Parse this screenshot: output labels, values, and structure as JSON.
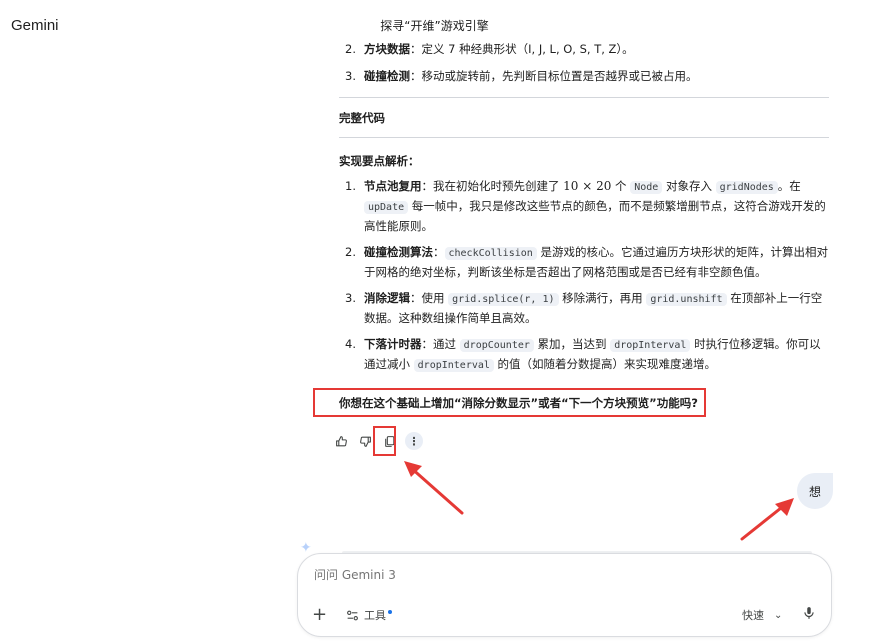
{
  "app": {
    "name": "Gemini"
  },
  "conversation": {
    "title": "探寻“开维”游戏引擎"
  },
  "steps_top": [
    {
      "num": "2.",
      "term": "方块数据",
      "text": "：定义 7 种经典形状（I, J, L, O, S, T, Z）。"
    },
    {
      "num": "3.",
      "term": "碰撞检测",
      "text": "：移动或旋转前，先判断目标位置是否越界或已被占用。"
    }
  ],
  "section_full_code": "完整代码",
  "section_points": "实现要点解析：",
  "points": [
    {
      "num": "1.",
      "term": "节点池复用",
      "t1": "：我在初始化时预先创建了 ",
      "math": "10 × 20",
      "t2": " 个 ",
      "c1": "Node",
      "t3": " 对象存入 ",
      "c2": "gridNodes",
      "t4": "。在",
      "c3": "upDate",
      "t5": " 每一帧中，我只是修改这些节点的颜色，而不是频繁增删节点，这符合游戏开发的高性能原则。"
    },
    {
      "num": "2.",
      "term": "碰撞检测算法",
      "t0": "：",
      "c1": "checkCollision",
      "t1": " 是游戏的核心。它通过遍历方块形状的矩阵，计算出相对于网格的绝对坐标，判断该坐标是否超出了网格范围或是否已经有非空颜色值。"
    },
    {
      "num": "3.",
      "term": "消除逻辑",
      "t0": "：使用 ",
      "c1": "grid.splice(r, 1)",
      "t1": " 移除满行，再用 ",
      "c2": "grid.unshift",
      "t2": " 在顶部补上一行空数据。这种数组操作简单且高效。"
    },
    {
      "num": "4.",
      "term": "下落计时器",
      "t0": "：通过 ",
      "c1": "dropCounter",
      "t1": " 累加，当达到 ",
      "c2": "dropInterval",
      "t2": " 时执行位移逻辑。你可以通过减小 ",
      "c3": "dropInterval",
      "t3": " 的值（如随着分数提高）来实现难度递增。"
    }
  ],
  "followup_question": "你想在这个基础上增加“消除分数显示”或者“下一个方块预览”功能吗?",
  "actions": {
    "thumbs_up": "thumb-up-icon",
    "thumbs_down": "thumb-down-icon",
    "copy": "copy-icon",
    "more": "more-vert-icon",
    "more_glyph": "⋮"
  },
  "user_message": "想",
  "composer": {
    "placeholder": "问问 Gemini 3",
    "plus": "+",
    "tools_label": "工具",
    "mode_label": "快速",
    "mode_chevron": "⌄"
  },
  "colors": {
    "highlight": "#e53935",
    "bubble": "#e9eef6",
    "accent": "#1a73e8"
  }
}
